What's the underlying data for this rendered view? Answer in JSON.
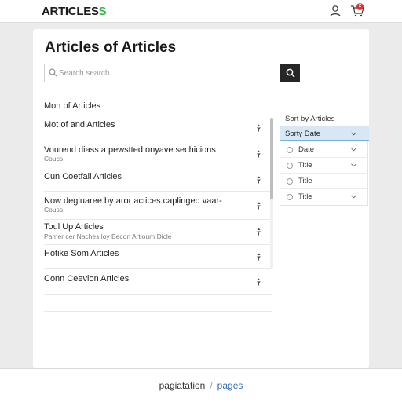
{
  "header": {
    "logo_main": "ARTICLES",
    "logo_accent": "S",
    "cart_count": "2",
    "icons": [
      "user-icon",
      "cart-icon"
    ]
  },
  "main": {
    "title": "Articles of Articles",
    "search": {
      "placeholder": "Search search",
      "value": "",
      "icon": "search-icon",
      "button_icon": "search-icon"
    },
    "section_heading": "Mon of Articles",
    "articles": [
      {
        "title": "Mot of and Articles",
        "subtitle": ""
      },
      {
        "title": "Vourend diass a pewstted onyave sechicions",
        "subtitle": "Coucs"
      },
      {
        "title": "Cun Coetfall Articles",
        "subtitle": ""
      },
      {
        "title": "Now degluaree by aror actices caplinged vaar-",
        "subtitle": "Couss"
      },
      {
        "title": "Toul Up Articles",
        "subtitle": "Pamer cer Naches loy Becon Artioum Dicle"
      },
      {
        "title": "Hotike Som Articles",
        "subtitle": ""
      },
      {
        "title": "Conn Ceevion Articles",
        "subtitle": ""
      }
    ],
    "item_icon": "pin-icon",
    "scroll_position": 0.0
  },
  "sort": {
    "label": "Sort by Articles",
    "selected": "Sorty Date",
    "options": [
      {
        "label": "Date",
        "has_chevron": true
      },
      {
        "label": "Title",
        "has_chevron": true
      },
      {
        "label": "Title",
        "has_chevron": false
      },
      {
        "label": "Title",
        "has_chevron": true
      }
    ]
  },
  "footer": {
    "pagination_label": "pagiatation",
    "separator": "/",
    "pages_link": "pages"
  },
  "colors": {
    "accent": "#39b54a",
    "badge": "#e0312b",
    "selected_bg": "#d7e7f5",
    "link": "#2f6fb5",
    "search_button": "#262626"
  }
}
